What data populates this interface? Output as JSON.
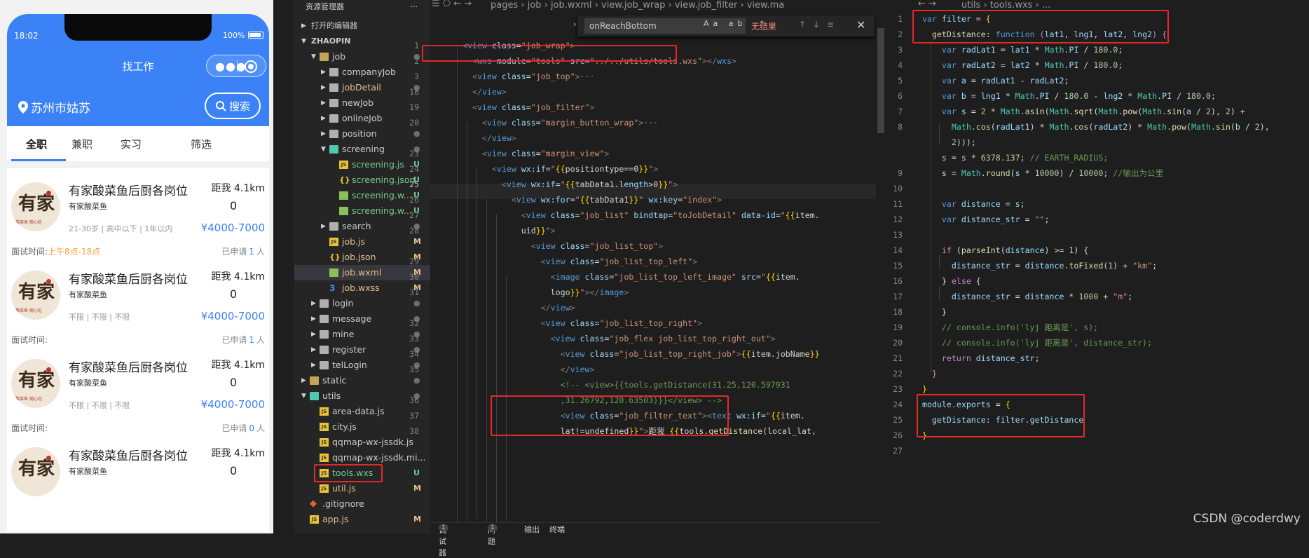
{
  "phone": {
    "time": "18:02",
    "battery": "100%",
    "title": "找工作",
    "location": "苏州市姑苏",
    "search": "搜索",
    "tabs": [
      "全职",
      "兼职",
      "实习",
      "筛选"
    ],
    "jobs": [
      {
        "name": "有家酸菜鱼后厨各岗位",
        "company": "有家酸菜鱼",
        "req": "21-30岁 | 高中以下 | 1年以内",
        "dist": "距我 4.1km",
        "num": "0",
        "salary": "¥4000-7000",
        "iv_label": "面试时间:",
        "iv_value": "上午8点-18点",
        "apply_pre": "已申请",
        "apply_count": "1",
        "apply_post": "人"
      },
      {
        "name": "有家酸菜鱼后厨各岗位",
        "company": "有家酸菜鱼",
        "req": "不限 | 不限 | 不限",
        "dist": "距我 4.1km",
        "num": "0",
        "salary": "¥4000-7000",
        "iv_label": "面试时间:",
        "iv_value": "",
        "apply_pre": "已申请",
        "apply_count": "1",
        "apply_post": "人"
      },
      {
        "name": "有家酸菜鱼后厨各岗位",
        "company": "有家酸菜鱼",
        "req": "不限 | 不限 | 不限",
        "dist": "距我 4.1km",
        "num": "0",
        "salary": "¥4000-7000",
        "iv_label": "面试时间:",
        "iv_value": "",
        "apply_pre": "已申请",
        "apply_count": "0",
        "apply_post": "人"
      },
      {
        "name": "有家酸菜鱼后厨各岗位",
        "company": "有家酸菜鱼",
        "req": "",
        "dist": "距我 4.1km",
        "num": "0",
        "salary": "",
        "iv_label": "",
        "iv_value": "",
        "apply_pre": "",
        "apply_count": "",
        "apply_post": ""
      }
    ],
    "logo_big": "有家",
    "logo_small": "酸菜鱼 随心吃"
  },
  "explorer": {
    "title": "资源管理器",
    "more": "···",
    "open_editors": "打开的编辑器",
    "project": "ZHAOPIN",
    "rows": [
      {
        "n": "job",
        "t": "folder",
        "s": "●",
        "open": true
      },
      {
        "n": "companyJob",
        "t": "dir",
        "s": ""
      },
      {
        "n": "jobDetail",
        "t": "dir",
        "s": "●"
      },
      {
        "n": "newJob",
        "t": "dir",
        "s": ""
      },
      {
        "n": "onlineJob",
        "t": "dir",
        "s": ""
      },
      {
        "n": "position",
        "t": "dir",
        "s": "●"
      },
      {
        "n": "screening",
        "t": "teal",
        "s": "●",
        "open": true
      },
      {
        "n": "screening.js",
        "t": "js",
        "s": "U"
      },
      {
        "n": "screening.json",
        "t": "json",
        "s": "U"
      },
      {
        "n": "screening.w...",
        "t": "wxml",
        "s": "U"
      },
      {
        "n": "screening.w...",
        "t": "wxml",
        "s": "U"
      },
      {
        "n": "search",
        "t": "dir",
        "s": "●"
      },
      {
        "n": "job.js",
        "t": "js",
        "s": "M"
      },
      {
        "n": "job.json",
        "t": "json",
        "s": "M"
      },
      {
        "n": "job.wxml",
        "t": "wxml",
        "s": "M"
      },
      {
        "n": "job.wxss",
        "t": "wxss",
        "s": "M"
      },
      {
        "n": "login",
        "t": "dir",
        "s": "●"
      },
      {
        "n": "message",
        "t": "dir",
        "s": "●"
      },
      {
        "n": "mine",
        "t": "dir",
        "s": "●"
      },
      {
        "n": "register",
        "t": "dir",
        "s": "●"
      },
      {
        "n": "telLogin",
        "t": "dir",
        "s": "●"
      },
      {
        "n": "static",
        "t": "folder",
        "s": "●"
      },
      {
        "n": "utils",
        "t": "teal",
        "s": "●",
        "open": true
      },
      {
        "n": "area-data.js",
        "t": "js",
        "s": ""
      },
      {
        "n": "city.js",
        "t": "js",
        "s": ""
      },
      {
        "n": "qqmap-wx-jssdk.js",
        "t": "js",
        "s": ""
      },
      {
        "n": "qqmap-wx-jssdk.mi...",
        "t": "js",
        "s": ""
      },
      {
        "n": "tools.wxs",
        "t": "js",
        "s": "U"
      },
      {
        "n": "util.js",
        "t": "js",
        "s": "M"
      },
      {
        "n": ".gitignore",
        "t": "git",
        "s": ""
      },
      {
        "n": "app.js",
        "t": "js",
        "s": "M"
      }
    ]
  },
  "editor1": {
    "breadcrumb": "pages › job › job.wxml › view.job_wrap › view.job_filter › view.ma",
    "find": {
      "value": "onReachBottom",
      "opts": "Aa ab .*",
      "result": "无结果"
    },
    "line_numbers": [
      "1",
      "2",
      "3",
      "18",
      "19",
      "20",
      "",
      "23",
      "24",
      "25",
      "26",
      "27",
      "28",
      "",
      "29",
      "30",
      "31",
      "",
      "32",
      "33",
      "34",
      "35",
      "",
      "36",
      "37",
      "38",
      ""
    ],
    "panel": {
      "debug": "调试器",
      "debug_count": "1",
      "issues": "问题",
      "issues_count": "1",
      "output": "输出",
      "terminal": "终端"
    }
  },
  "editor2": {
    "breadcrumb": "utils › tools.wxs › ...",
    "line_numbers": [
      "1",
      "2",
      "3",
      "4",
      "5",
      "6",
      "7",
      "8",
      "",
      "",
      "9",
      "10",
      "11",
      "12",
      "13",
      "14",
      "15",
      "16",
      "17",
      "18",
      "19",
      "20",
      "21",
      "22",
      "23",
      "24",
      "25",
      "26",
      "27"
    ]
  },
  "watermark": "CSDN @coderdwy"
}
